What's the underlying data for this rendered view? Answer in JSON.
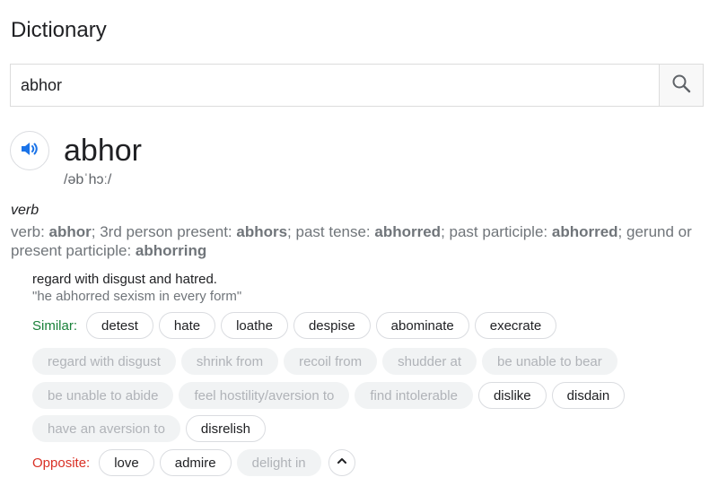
{
  "page": {
    "title": "Dictionary"
  },
  "search": {
    "value": "abhor"
  },
  "entry": {
    "word": "abhor",
    "pronunciation": "/əbˈhɔː/",
    "pos": "verb",
    "forms": [
      {
        "label": "verb: ",
        "value": "abhor"
      },
      {
        "label": "; 3rd person present: ",
        "value": "abhors"
      },
      {
        "label": "; past tense: ",
        "value": "abhorred"
      },
      {
        "label": "; past participle: ",
        "value": "abhorred"
      },
      {
        "label": "; gerund or present participle: ",
        "value": "abhorring"
      }
    ],
    "definition": "regard with disgust and hatred.",
    "example": "\"he abhorred sexism in every form\""
  },
  "similar": {
    "label": "Similar:",
    "label_color": "#188038",
    "row1": [
      "detest",
      "hate",
      "loathe",
      "despise",
      "abominate",
      "execrate"
    ],
    "row2": [
      "regard with disgust",
      "shrink from",
      "recoil from",
      "shudder at",
      "be unable to bear"
    ],
    "row3_faded": [
      "be unable to abide",
      "feel hostility/aversion to",
      "find intolerable"
    ],
    "row3_active": [
      "dislike",
      "disdain"
    ],
    "row4_faded": [
      "have an aversion to"
    ],
    "row4_active": [
      "disrelish"
    ]
  },
  "opposite": {
    "label": "Opposite:",
    "label_color": "#d93025",
    "active": [
      "love",
      "admire"
    ],
    "faded": [
      "delight in"
    ]
  },
  "icons": {
    "search": "search-icon",
    "audio": "speaker-icon",
    "collapse": "chevron-up-icon"
  },
  "colors": {
    "accent": "#1a73e8"
  }
}
